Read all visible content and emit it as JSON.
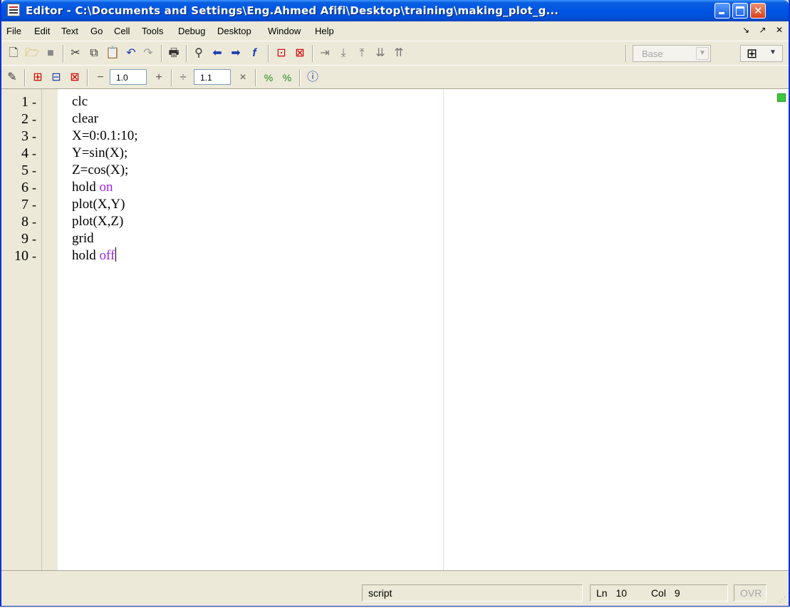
{
  "window": {
    "title": "Editor - C:\\Documents and Settings\\Eng.Ahmed Afifi\\Desktop\\training\\making_plot_g..."
  },
  "menubar": {
    "items": [
      "File",
      "Edit",
      "Text",
      "Go",
      "Cell",
      "Tools",
      "Debug",
      "Desktop",
      "Window",
      "Help"
    ],
    "right_controls": [
      "↘",
      "↗",
      "✕"
    ]
  },
  "toolbar": {
    "icons": [
      "new-file-icon",
      "open-file-icon",
      "save-icon",
      "cut-icon",
      "copy-icon",
      "paste-icon",
      "undo-icon",
      "redo-icon",
      "print-icon",
      "find-icon",
      "back-icon",
      "forward-icon",
      "function-icon",
      "set-breakpoint-icon",
      "clear-breakpoint-icon",
      "step-icon",
      "step-in-icon",
      "step-out-icon",
      "continue-icon",
      "exit-debug-icon"
    ],
    "stack_select": "Base"
  },
  "cell_toolbar": {
    "decrement_label": "−",
    "value_1": "1.0",
    "increment_label": "+",
    "divide_label": "÷",
    "value_2": "1.1",
    "multiply_label": "×"
  },
  "editor": {
    "lines": [
      {
        "number": "1",
        "marker": "-",
        "code": "clc",
        "keyword": ""
      },
      {
        "number": "2",
        "marker": "-",
        "code": "clear",
        "keyword": ""
      },
      {
        "number": "3",
        "marker": "-",
        "code": "X=0:0.1:10;",
        "keyword": ""
      },
      {
        "number": "4",
        "marker": "-",
        "code": "Y=sin(X);",
        "keyword": ""
      },
      {
        "number": "5",
        "marker": "-",
        "code": "Z=cos(X);",
        "keyword": ""
      },
      {
        "number": "6",
        "marker": "-",
        "code": "hold ",
        "keyword": "on"
      },
      {
        "number": "7",
        "marker": "-",
        "code": "plot(X,Y)",
        "keyword": ""
      },
      {
        "number": "8",
        "marker": "-",
        "code": "plot(X,Z)",
        "keyword": ""
      },
      {
        "number": "9",
        "marker": "-",
        "code": "grid",
        "keyword": ""
      },
      {
        "number": "10",
        "marker": "-",
        "code": "hold ",
        "keyword": "off"
      }
    ],
    "keyword_color": "#a020f0"
  },
  "statusbar": {
    "mode": "script",
    "line_label": "Ln",
    "line_value": "10",
    "col_label": "Col",
    "col_value": "9",
    "ovr": "OVR"
  }
}
